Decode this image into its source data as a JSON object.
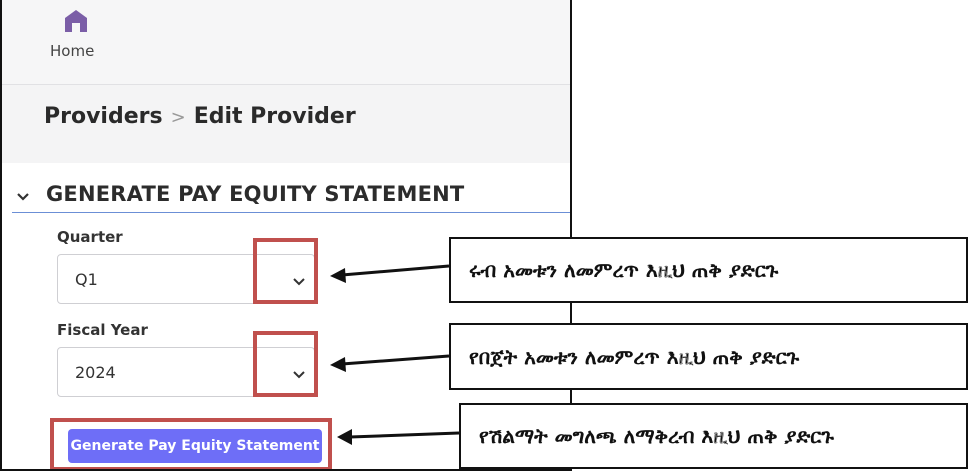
{
  "nav": {
    "home_label": "Home",
    "accent": "#7b5ea7"
  },
  "breadcrumb": {
    "parent": "Providers",
    "separator": ">",
    "current": "Edit Provider"
  },
  "section": {
    "title": "GENERATE PAY EQUITY STATEMENT"
  },
  "form": {
    "quarter": {
      "label": "Quarter",
      "value": "Q1"
    },
    "fiscal_year": {
      "label": "Fiscal Year",
      "value": "2024"
    },
    "generate_button": {
      "label": "Generate Pay Equity Statement",
      "color": "#6e6ef7"
    }
  },
  "annotations": {
    "highlight_color": "#c0504d",
    "quarter_callout": "ሩብ አመቱን ለመምረጥ እዚህ ጠቅ ያድርጉ",
    "fiscal_year_callout": "የበጀት አመቱን ለመምረጥ እዚህ ጠቅ ያድርጉ",
    "generate_callout": "የሽልማት መግለጫ ለማቅረብ እዚህ ጠቅ ያድርጉ"
  }
}
